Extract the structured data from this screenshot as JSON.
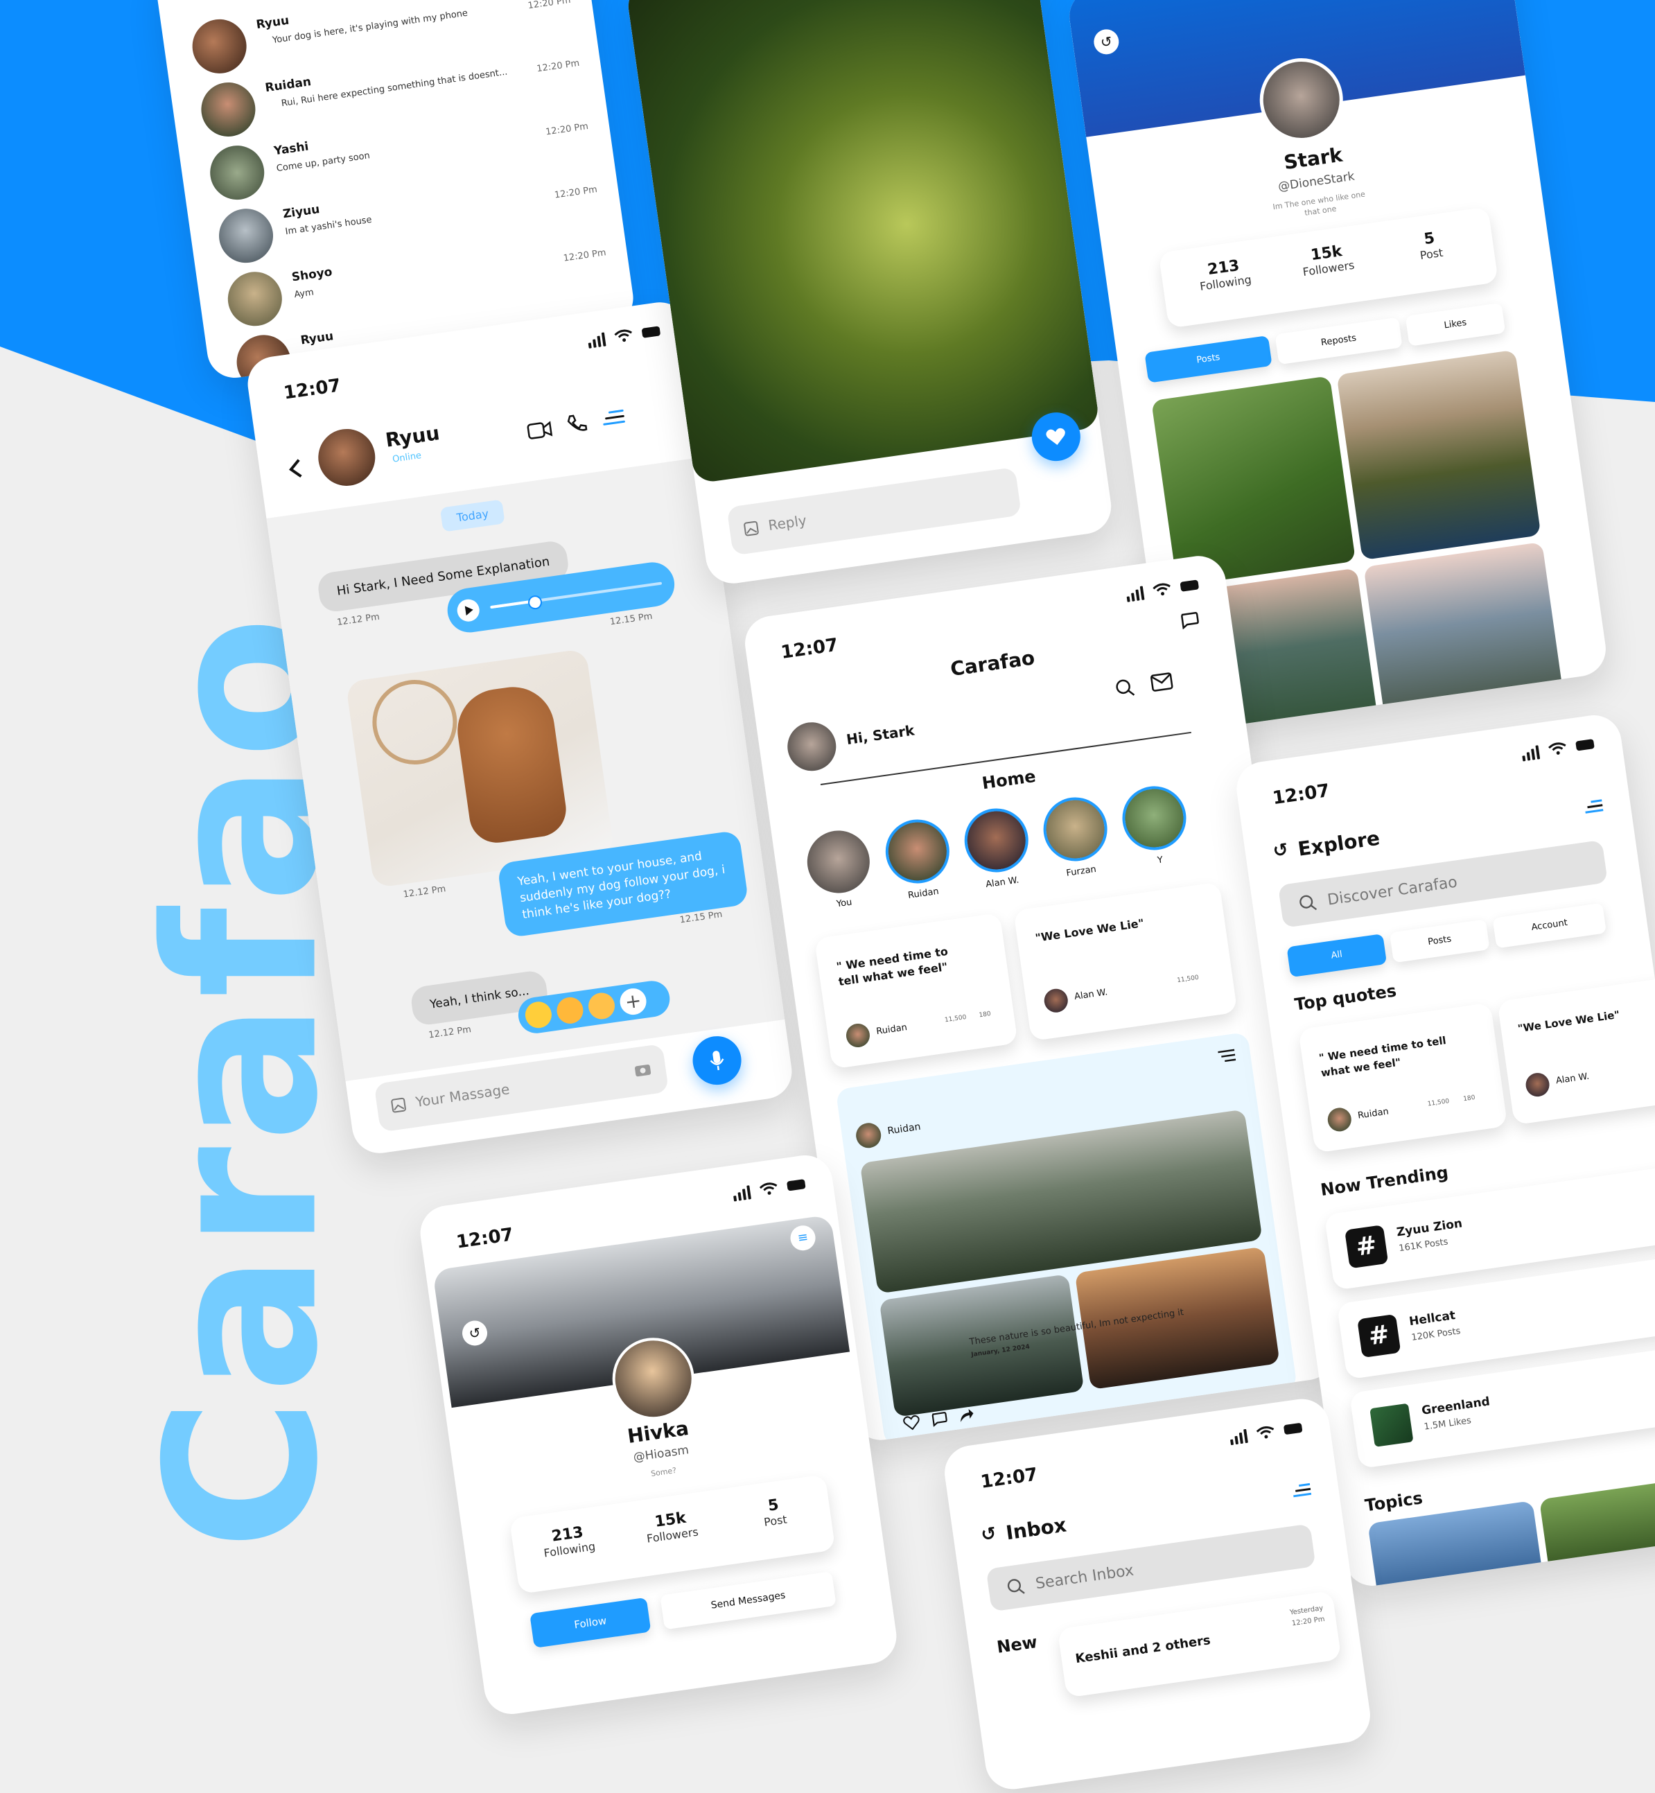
{
  "brand": {
    "name": "Carafao",
    "color": "#74ccff",
    "accent": "#1f9cff"
  },
  "status": {
    "time": "12:07"
  },
  "chatlist": {
    "items": [
      {
        "name": "Ryuu",
        "message": "Your dog is here, it's playing with my phone",
        "time": "12:20 Pm"
      },
      {
        "name": "Ruidan",
        "message": "Rui, Rui here expecting something that is doesnt...",
        "time": "12:20 Pm"
      },
      {
        "name": "Yashi",
        "message": "Come up, party soon",
        "time": "12:20 Pm"
      },
      {
        "name": "Ziyuu",
        "message": "Im at yashi's house",
        "time": "12:20 Pm"
      },
      {
        "name": "Shoyo",
        "message": "Aym",
        "time": "12:20 Pm"
      },
      {
        "name": "Ryuu",
        "message": "",
        "time": ""
      }
    ]
  },
  "chat": {
    "contact": "Ryuu",
    "presence": "Online",
    "day": "Today",
    "msg1": "Hi Stark, I Need Some Explanation",
    "msg1_time": "12.12 Pm",
    "voice_time": "12.15 Pm",
    "voice_progress": 0.25,
    "photo_time": "12.12 Pm",
    "msg2": "Yeah, I went to your house, and suddenly my dog follow your dog, i think he's like your dog??",
    "msg2_time": "12.15 Pm",
    "msg3": "Yeah, I think so...",
    "msg3_time": "12.12 Pm",
    "input_placeholder": "Your Massage"
  },
  "story": {
    "reply_placeholder": "Reply"
  },
  "profile_stark": {
    "name": "Stark",
    "handle": "@DioneStark",
    "bio": "Im The one who like one that one",
    "stats": [
      {
        "value": "213",
        "label": "Following"
      },
      {
        "value": "15k",
        "label": "Followers"
      },
      {
        "value": "5",
        "label": "Post"
      }
    ],
    "tabs": [
      "Posts",
      "Reposts",
      "Likes"
    ]
  },
  "home": {
    "app": "Carafao",
    "greeting": "Hi, Stark",
    "section": "Home",
    "stories": [
      "You",
      "Ruidan",
      "Alan W.",
      "Furzan",
      "Y"
    ],
    "quotes": [
      {
        "text": "\" We need time to tell what we feel\"",
        "author": "Ruidan",
        "views": "11,500",
        "comments": "180"
      },
      {
        "text": "\"We Love We Lie\"",
        "author": "Alan W.",
        "views": "11,500",
        "comments": ""
      }
    ],
    "post": {
      "author": "Ruidan",
      "caption": "These nature is so beautiful, Im not expecting it",
      "date": "January, 12 2024"
    }
  },
  "explore": {
    "title": "Explore",
    "search_placeholder": "Discover Carafao",
    "tabs": [
      "All",
      "Posts",
      "Account"
    ],
    "top_quotes_title": "Top quotes",
    "quotes": [
      {
        "text": "\" We need time to tell what we feel\"",
        "author": "Ruidan",
        "views": "11,500",
        "comments": "180"
      },
      {
        "text": "\"We Love We Lie\"",
        "author": "Alan W."
      }
    ],
    "trending_title": "Now Trending",
    "trending": [
      {
        "name": "Zyuu Zion",
        "count": "161K Posts"
      },
      {
        "name": "Hellcat",
        "count": "120K Posts"
      },
      {
        "name": "Greenland",
        "count": "1.5M Likes"
      }
    ],
    "topics_title": "Topics"
  },
  "profile_hivka": {
    "name": "Hivka",
    "handle": "@Hioasm",
    "bio": "Some?",
    "stats": [
      {
        "value": "213",
        "label": "Following"
      },
      {
        "value": "15k",
        "label": "Followers"
      },
      {
        "value": "5",
        "label": "Post"
      }
    ],
    "follow": "Follow",
    "send": "Send Messages"
  },
  "inbox": {
    "title": "Inbox",
    "search_placeholder": "Search Inbox",
    "section": "New",
    "item_text": "Keshii and 2 others",
    "item_day": "Yesterday",
    "item_time": "12:20 Pm"
  }
}
